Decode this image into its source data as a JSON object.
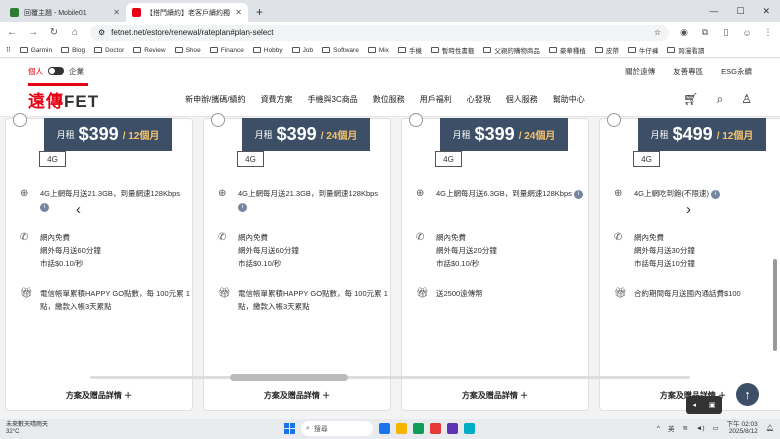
{
  "browser": {
    "tabs": [
      {
        "title": "回覆主題 - Mobile01",
        "favicon_color": "#2e7d32"
      },
      {
        "title": "【搭門續約】老客戶續約獨機優惠",
        "favicon_color": "#e60012"
      }
    ],
    "url": "fetnet.net/estore/renewal/rateplan#plan-select",
    "bookmarks": [
      "Garmin",
      "Blog",
      "Doctor",
      "Review",
      "Shoe",
      "Finance",
      "Hobby",
      "Job",
      "Software",
      "Mix",
      "手機",
      "暫時性書籤",
      "父親的購物商品",
      "豪華種植",
      "皮帶",
      "牛仔褲",
      "跨漫看讀"
    ]
  },
  "site": {
    "toggle": {
      "personal": "個人",
      "enterprise": "企業"
    },
    "top_links": [
      "關於遠傳",
      "友善專區",
      "ESG永續"
    ],
    "logo": {
      "red": "遠傳",
      "black": "FET"
    },
    "menu": [
      "新申辦/攜碼/續約",
      "資費方案",
      "手機與3C商品",
      "數位服務",
      "用戶福利",
      "心發現",
      "個人服務",
      "幫助中心"
    ]
  },
  "plans": [
    {
      "label": "月租",
      "price": "$399",
      "period": "/ 12個月",
      "network": "4G",
      "data": "4G上網每月送21.3GB，到量網速128Kbps",
      "voice": "網內免費\n網外每月送60分鐘\n市話$0.10/秒",
      "gift": "電信帳單累積HAPPY GO點數，每 100元累 1 點，繳款入帳3天累點",
      "details": "方案及贈品詳情 ＋"
    },
    {
      "label": "月租",
      "price": "$399",
      "period": "/ 24個月",
      "network": "4G",
      "data": "4G上網每月送21.3GB，到量網速128Kbps",
      "voice": "網內免費\n網外每月送60分鐘\n市話$0.10/秒",
      "gift": "電信帳單累積HAPPY GO點數，每 100元累 1 點，繳款入帳3天累點",
      "details": "方案及贈品詳情 ＋"
    },
    {
      "label": "月租",
      "price": "$399",
      "period": "/ 24個月",
      "network": "4G",
      "data": "4G上網每月送6.3GB，到量網速128Kbps",
      "voice": "網內免費\n網外每月送20分鐘\n市話$0.10/秒",
      "gift": "送2500遠傳幣",
      "details": "方案及贈品詳情 ＋"
    },
    {
      "label": "月租",
      "price": "$499",
      "period": "/ 12個月",
      "network": "4G",
      "data": "4G上網吃到飽(不限速)",
      "voice": "網內免費\n網外每月送30分鐘\n市話每月送10分鐘",
      "gift": "合約期間每月送國內通話費$100",
      "details": "方案及贈品詳情 ＋"
    }
  ],
  "taskbar": {
    "weather": "未來數天晴雨天",
    "temp": "32°C",
    "search_placeholder": "搜尋",
    "lang": "英",
    "time": "下午 02:03",
    "date": "2025/8/12",
    "app_colors": [
      "#1a73e8",
      "#f4b400",
      "#0f9d58",
      "#e53935",
      "#5e35b1",
      "#00acc1"
    ]
  }
}
